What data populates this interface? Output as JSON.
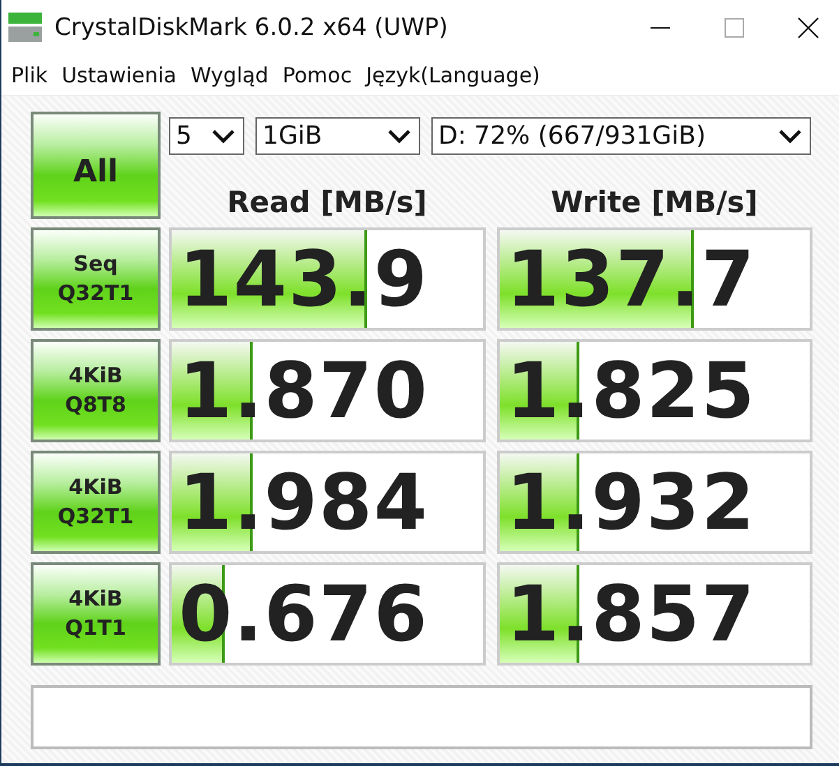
{
  "window": {
    "title": "CrystalDiskMark 6.0.2 x64 (UWP)"
  },
  "menu": [
    "Plik",
    "Ustawienia",
    "Wygląd",
    "Pomoc",
    "Język(Language)"
  ],
  "all_button": "All",
  "selectors": [
    {
      "value": "5"
    },
    {
      "value": "1GiB"
    },
    {
      "value": "D: 72% (667/931GiB)"
    }
  ],
  "headers": [
    "Read [MB/s]",
    "Write [MB/s]"
  ],
  "rows": [
    {
      "label": [
        "Seq",
        "Q32T1"
      ],
      "read": {
        "value": "143.9",
        "level": 0.62
      },
      "write": {
        "value": "137.7",
        "level": 0.62
      }
    },
    {
      "label": [
        "4KiB",
        "Q8T8"
      ],
      "read": {
        "value": "1.870",
        "level": 0.25
      },
      "write": {
        "value": "1.825",
        "level": 0.25
      }
    },
    {
      "label": [
        "4KiB",
        "Q32T1"
      ],
      "read": {
        "value": "1.984",
        "level": 0.25
      },
      "write": {
        "value": "1.932",
        "level": 0.25
      }
    },
    {
      "label": [
        "4KiB",
        "Q1T1"
      ],
      "read": {
        "value": "0.676",
        "level": 0.16
      },
      "write": {
        "value": "1.857",
        "level": 0.25
      }
    }
  ]
}
